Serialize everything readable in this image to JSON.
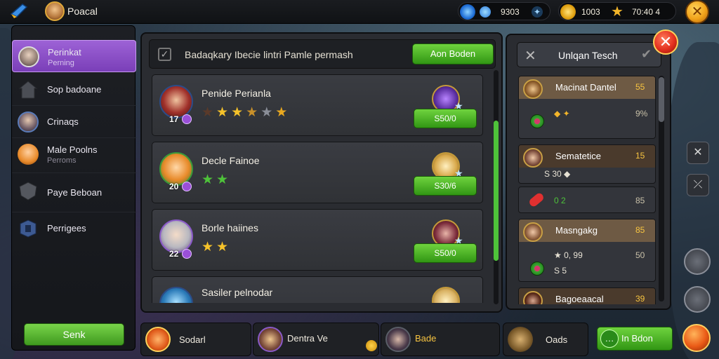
{
  "topbar": {
    "player_name": "Poacal",
    "gems": {
      "icon": "blue-gem-icon",
      "value": "9303"
    },
    "gold": {
      "icon": "gold-coin-icon",
      "value": "1003"
    },
    "energy": {
      "icon": "star-energy-icon",
      "value": "70:40 4"
    },
    "close": "✕"
  },
  "sidebar": {
    "items": [
      {
        "label": "Perinkat",
        "sub": "Perning",
        "icon": "hero-portrait-icon",
        "active": true
      },
      {
        "label": "Sop badoane",
        "sub": "",
        "icon": "house-icon",
        "active": false
      },
      {
        "label": "Crinaqs",
        "sub": "",
        "icon": "portrait-icon",
        "active": false
      },
      {
        "label": "Male Poolns",
        "sub": "Perroms",
        "icon": "fox-hero-icon",
        "active": false
      },
      {
        "label": "Paye Beboan",
        "sub": "",
        "icon": "shield-icon",
        "active": false
      },
      {
        "label": "Perrigees",
        "sub": "",
        "icon": "badge-icon",
        "active": false
      }
    ],
    "button": "Senk"
  },
  "main": {
    "header_text": "Badaqkary Ibecie lintri Pamle permash",
    "header_button": "Aon Boden",
    "cards": [
      {
        "name": "Penide Perianla",
        "level": "17",
        "stars": 6,
        "price": "S50/0",
        "icon": "purple-sword-icon"
      },
      {
        "name": "Decle Fainoe",
        "level": "20",
        "stars": 2,
        "price": "S30/6",
        "icon": "blonde-hero-icon"
      },
      {
        "name": "Borle haiines",
        "level": "22",
        "stars": 2,
        "price": "S50/0",
        "icon": "dark-hero-icon"
      },
      {
        "name": "Sasiler pelnodar",
        "level": "",
        "stars": 0,
        "price": "",
        "icon": "hero-icon"
      }
    ]
  },
  "right": {
    "title": "Unlqan Tesch",
    "close_x": "✕",
    "check": "✔",
    "cards": [
      {
        "name": "Macinat Dantel",
        "num": "55",
        "row1": "◆ ✦",
        "val1": "9%",
        "style": "light"
      },
      {
        "name": "Sematetice",
        "num": "15",
        "row1": "S 30 ◆",
        "val1": "",
        "style": "dark"
      },
      {
        "name": "",
        "num": "",
        "row1": "0 2",
        "val1": "85",
        "style": "none"
      },
      {
        "name": "Masngakg",
        "num": "85",
        "row1": "★ 0, 99",
        "val1": "50",
        "row2": "S 5",
        "style": "light"
      },
      {
        "name": "Bagoeaacal",
        "num": "39",
        "row1": "",
        "val1": "",
        "style": "dark"
      }
    ],
    "big_close": "✕",
    "tool1": "✕",
    "tool2": "⤫"
  },
  "bottom": {
    "left_label": "Sodarl",
    "slot1_label": "Dentra Ve",
    "slot2_label": "Bade",
    "slot3_label": "Oads",
    "green_button": "In Bdon"
  }
}
